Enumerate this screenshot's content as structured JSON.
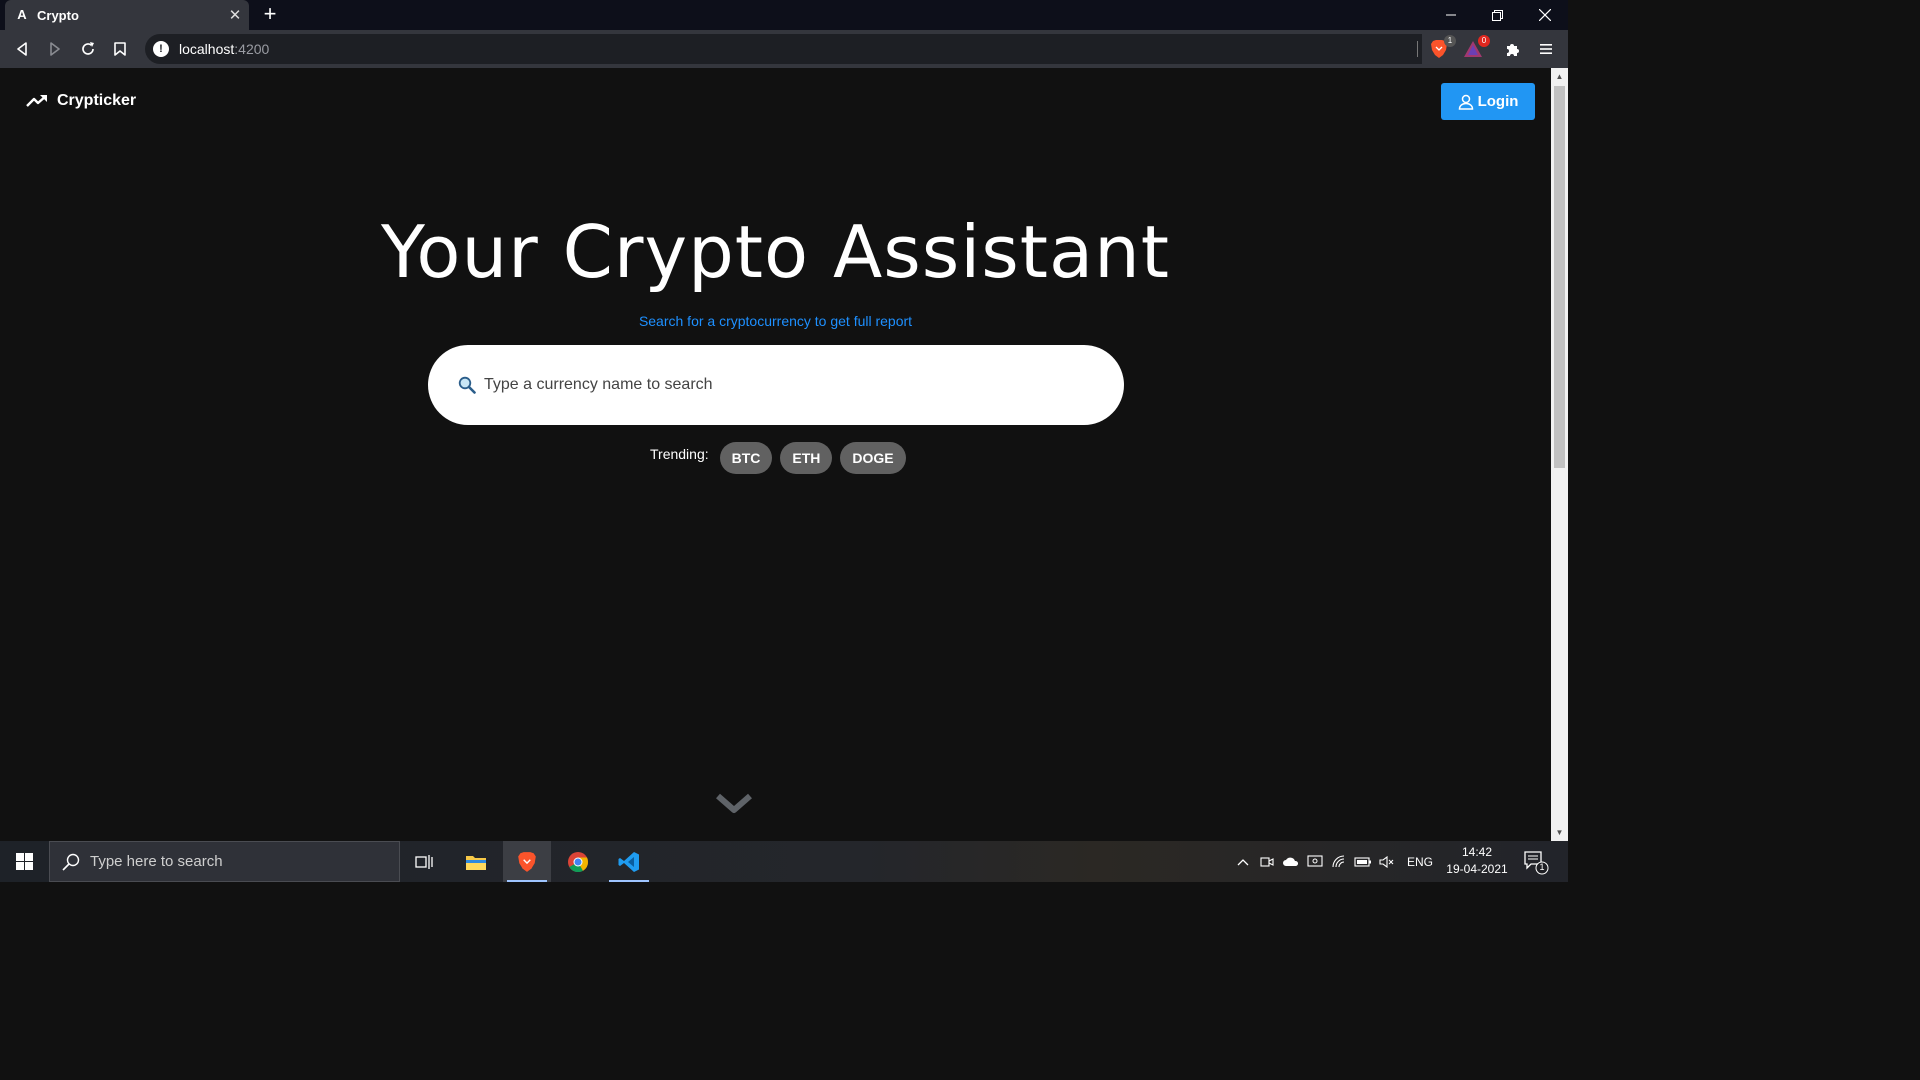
{
  "browser": {
    "tab_title": "Crypto",
    "tab_favicon": "A",
    "url_host": "localhost",
    "url_port": ":4200",
    "brave_badge": "1",
    "rewards_badge": "0"
  },
  "page": {
    "brand": "Crypticker",
    "login_label": "Login",
    "hero_title": "Your Crypto Assistant",
    "hero_subtitle": "Search for a cryptocurrency to get full report",
    "search_placeholder": "Type a currency name to search",
    "trending_label": "Trending:",
    "trending": [
      "BTC",
      "ETH",
      "DOGE"
    ]
  },
  "taskbar": {
    "search_placeholder": "Type here to search",
    "language": "ENG",
    "time": "14:42",
    "date": "19-04-2021",
    "notification_count": "1"
  },
  "colors": {
    "accent": "#2196f3",
    "subtitle": "#1e90ff",
    "page_bg": "#111111",
    "chip_bg": "#616161"
  }
}
